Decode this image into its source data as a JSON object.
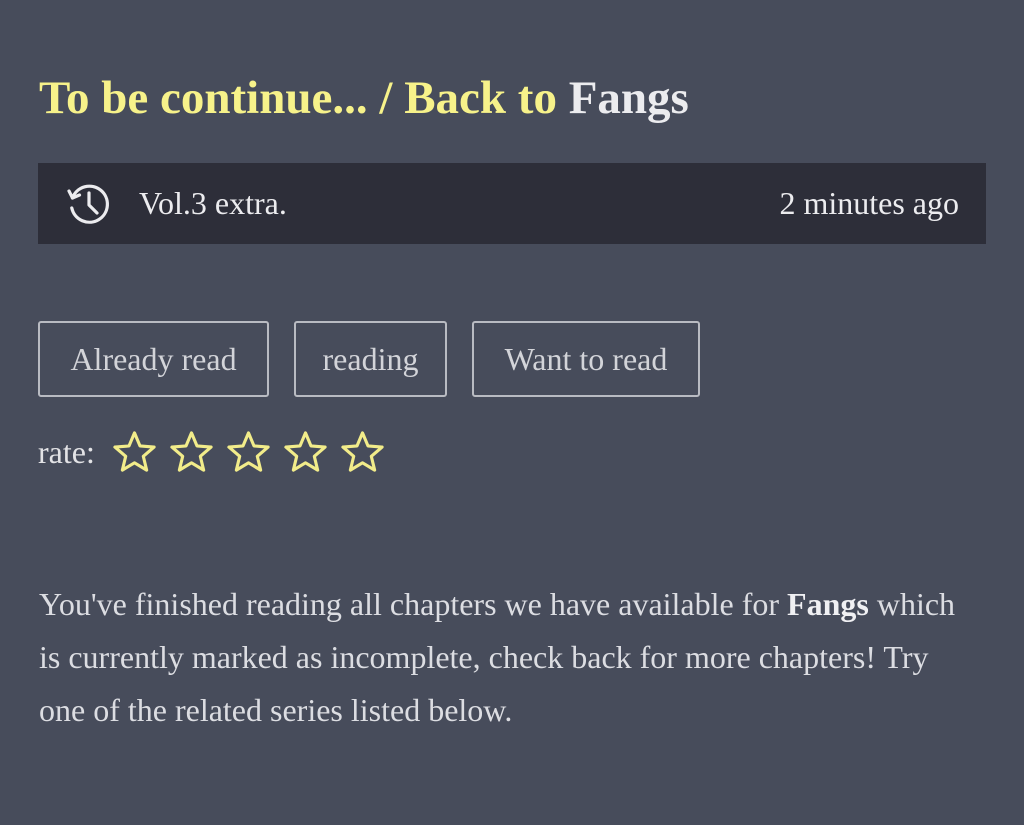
{
  "heading": {
    "prefix": "To be continue... / Back to ",
    "series_title": "Fangs"
  },
  "latest_chapter": {
    "icon": "history-icon",
    "name": "Vol.3 extra.",
    "time_ago": "2 minutes ago"
  },
  "reading_status": {
    "buttons": [
      "Already read",
      "reading",
      "Want to read"
    ]
  },
  "rating": {
    "label": "rate:",
    "max_stars": 5,
    "current": 0,
    "star_color": "#f2ec8a"
  },
  "message": {
    "part1": "You've finished reading all chapters we have available for ",
    "series": "Fangs",
    "part2": " which is currently marked as incomplete, check back for more chapters! Try one of the related series listed below."
  },
  "colors": {
    "background": "#474c5b",
    "bar_background": "#2d2e39",
    "accent": "#f7f28a"
  }
}
